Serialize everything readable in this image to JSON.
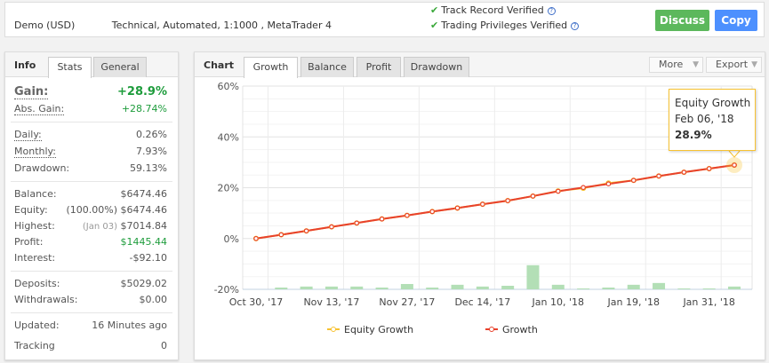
{
  "header": {
    "account": "Demo (USD)",
    "description": "Technical, Automated, 1:1000 , MetaTrader 4",
    "verifications": [
      "Track Record Verified",
      "Trading Privileges Verified"
    ],
    "help_glyph": "?",
    "discuss": "Discuss",
    "copy": "Copy",
    "colors": {
      "discuss": "#5cb85c",
      "copy": "#4d90fe",
      "check": "#3aa83a"
    }
  },
  "info": {
    "title": "Info",
    "tabs": [
      "Stats",
      "General"
    ],
    "gain": {
      "label": "Gain:",
      "value": "+28.9%"
    },
    "abs_gain": {
      "label": "Abs. Gain:",
      "value": "+28.74%"
    },
    "daily": {
      "label": "Daily:",
      "value": "0.26%"
    },
    "monthly": {
      "label": "Monthly:",
      "value": "7.93%"
    },
    "drawdown": {
      "label": "Drawdown:",
      "value": "59.13%"
    },
    "balance": {
      "label": "Balance:",
      "value": "$6474.46"
    },
    "equity": {
      "label": "Equity:",
      "note": "(100.00%)",
      "value": "$6474.46"
    },
    "highest": {
      "label": "Highest:",
      "note": "(Jan 03)",
      "value": "$7014.84"
    },
    "profit": {
      "label": "Profit:",
      "value": "$1445.44"
    },
    "interest": {
      "label": "Interest:",
      "value": "-$92.10"
    },
    "deposits": {
      "label": "Deposits:",
      "value": "$5029.02"
    },
    "withdrawals": {
      "label": "Withdrawals:",
      "value": "$0.00"
    },
    "updated": {
      "label": "Updated:",
      "value": "16 Minutes ago"
    },
    "tracking": {
      "label": "Tracking",
      "value": "0"
    }
  },
  "chart": {
    "title": "Chart",
    "tabs": [
      "Growth",
      "Balance",
      "Profit",
      "Drawdown"
    ],
    "more": "More",
    "export": "Export",
    "tooltip": {
      "series": "Equity Growth",
      "date": "Feb 06, '18",
      "value": "28.9%"
    }
  },
  "chart_data": {
    "type": "line",
    "ylim": [
      -20,
      60
    ],
    "yticks": [
      "60%",
      "40%",
      "20%",
      "0%",
      "-20%"
    ],
    "ytick_values": [
      60,
      40,
      20,
      0,
      -20
    ],
    "xtick_labels": [
      "Oct 30, '17",
      "Nov 13, '17",
      "Nov 27, '17",
      "Dec 14, '17",
      "Jan 10, '18",
      "Jan 19, '18",
      "Jan 31, '18"
    ],
    "grid": true,
    "legend": "bottom",
    "series": [
      {
        "name": "Equity Growth",
        "color": "#f7c232",
        "values": [
          0,
          1.5,
          3.0,
          4.6,
          6.1,
          7.7,
          9.1,
          10.6,
          12.0,
          13.5,
          14.9,
          16.7,
          18.7,
          19.8,
          21.8,
          22.9,
          24.6,
          26.1,
          27.5,
          28.9
        ]
      },
      {
        "name": "Growth",
        "color": "#e8412c",
        "values": [
          0,
          1.5,
          3.0,
          4.6,
          6.1,
          7.7,
          9.1,
          10.6,
          12.0,
          13.5,
          14.9,
          16.7,
          18.6,
          20.1,
          21.5,
          22.9,
          24.6,
          26.1,
          27.5,
          28.9
        ]
      }
    ],
    "bars": {
      "color": "#b3dfb6",
      "values": [
        null,
        0.7,
        1.1,
        1.1,
        1.1,
        0.7,
        2.1,
        0.7,
        1.8,
        1.1,
        1.4,
        9.5,
        1.8,
        0.35,
        0.7,
        1.8,
        2.5,
        0.35,
        0.35,
        1.1
      ]
    }
  }
}
